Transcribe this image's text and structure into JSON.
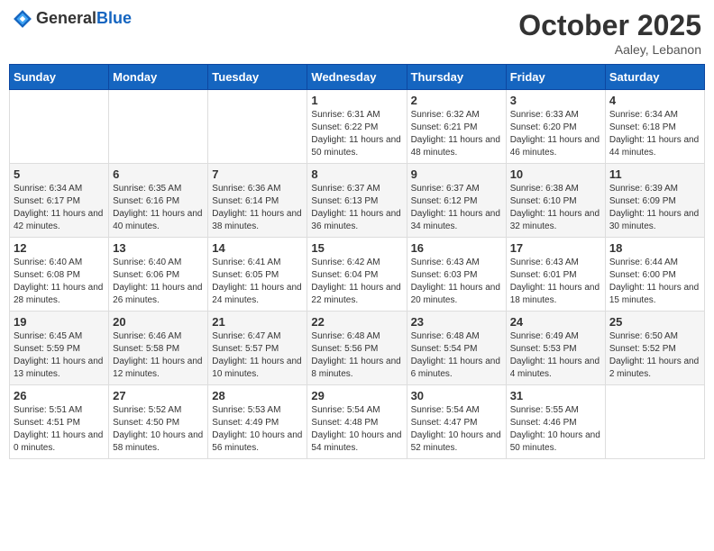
{
  "header": {
    "logo_general": "General",
    "logo_blue": "Blue",
    "month": "October 2025",
    "location": "Aaley, Lebanon"
  },
  "days_of_week": [
    "Sunday",
    "Monday",
    "Tuesday",
    "Wednesday",
    "Thursday",
    "Friday",
    "Saturday"
  ],
  "weeks": [
    [
      {
        "day": "",
        "info": ""
      },
      {
        "day": "",
        "info": ""
      },
      {
        "day": "",
        "info": ""
      },
      {
        "day": "1",
        "info": "Sunrise: 6:31 AM\nSunset: 6:22 PM\nDaylight: 11 hours and 50 minutes."
      },
      {
        "day": "2",
        "info": "Sunrise: 6:32 AM\nSunset: 6:21 PM\nDaylight: 11 hours and 48 minutes."
      },
      {
        "day": "3",
        "info": "Sunrise: 6:33 AM\nSunset: 6:20 PM\nDaylight: 11 hours and 46 minutes."
      },
      {
        "day": "4",
        "info": "Sunrise: 6:34 AM\nSunset: 6:18 PM\nDaylight: 11 hours and 44 minutes."
      }
    ],
    [
      {
        "day": "5",
        "info": "Sunrise: 6:34 AM\nSunset: 6:17 PM\nDaylight: 11 hours and 42 minutes."
      },
      {
        "day": "6",
        "info": "Sunrise: 6:35 AM\nSunset: 6:16 PM\nDaylight: 11 hours and 40 minutes."
      },
      {
        "day": "7",
        "info": "Sunrise: 6:36 AM\nSunset: 6:14 PM\nDaylight: 11 hours and 38 minutes."
      },
      {
        "day": "8",
        "info": "Sunrise: 6:37 AM\nSunset: 6:13 PM\nDaylight: 11 hours and 36 minutes."
      },
      {
        "day": "9",
        "info": "Sunrise: 6:37 AM\nSunset: 6:12 PM\nDaylight: 11 hours and 34 minutes."
      },
      {
        "day": "10",
        "info": "Sunrise: 6:38 AM\nSunset: 6:10 PM\nDaylight: 11 hours and 32 minutes."
      },
      {
        "day": "11",
        "info": "Sunrise: 6:39 AM\nSunset: 6:09 PM\nDaylight: 11 hours and 30 minutes."
      }
    ],
    [
      {
        "day": "12",
        "info": "Sunrise: 6:40 AM\nSunset: 6:08 PM\nDaylight: 11 hours and 28 minutes."
      },
      {
        "day": "13",
        "info": "Sunrise: 6:40 AM\nSunset: 6:06 PM\nDaylight: 11 hours and 26 minutes."
      },
      {
        "day": "14",
        "info": "Sunrise: 6:41 AM\nSunset: 6:05 PM\nDaylight: 11 hours and 24 minutes."
      },
      {
        "day": "15",
        "info": "Sunrise: 6:42 AM\nSunset: 6:04 PM\nDaylight: 11 hours and 22 minutes."
      },
      {
        "day": "16",
        "info": "Sunrise: 6:43 AM\nSunset: 6:03 PM\nDaylight: 11 hours and 20 minutes."
      },
      {
        "day": "17",
        "info": "Sunrise: 6:43 AM\nSunset: 6:01 PM\nDaylight: 11 hours and 18 minutes."
      },
      {
        "day": "18",
        "info": "Sunrise: 6:44 AM\nSunset: 6:00 PM\nDaylight: 11 hours and 15 minutes."
      }
    ],
    [
      {
        "day": "19",
        "info": "Sunrise: 6:45 AM\nSunset: 5:59 PM\nDaylight: 11 hours and 13 minutes."
      },
      {
        "day": "20",
        "info": "Sunrise: 6:46 AM\nSunset: 5:58 PM\nDaylight: 11 hours and 12 minutes."
      },
      {
        "day": "21",
        "info": "Sunrise: 6:47 AM\nSunset: 5:57 PM\nDaylight: 11 hours and 10 minutes."
      },
      {
        "day": "22",
        "info": "Sunrise: 6:48 AM\nSunset: 5:56 PM\nDaylight: 11 hours and 8 minutes."
      },
      {
        "day": "23",
        "info": "Sunrise: 6:48 AM\nSunset: 5:54 PM\nDaylight: 11 hours and 6 minutes."
      },
      {
        "day": "24",
        "info": "Sunrise: 6:49 AM\nSunset: 5:53 PM\nDaylight: 11 hours and 4 minutes."
      },
      {
        "day": "25",
        "info": "Sunrise: 6:50 AM\nSunset: 5:52 PM\nDaylight: 11 hours and 2 minutes."
      }
    ],
    [
      {
        "day": "26",
        "info": "Sunrise: 5:51 AM\nSunset: 4:51 PM\nDaylight: 11 hours and 0 minutes."
      },
      {
        "day": "27",
        "info": "Sunrise: 5:52 AM\nSunset: 4:50 PM\nDaylight: 10 hours and 58 minutes."
      },
      {
        "day": "28",
        "info": "Sunrise: 5:53 AM\nSunset: 4:49 PM\nDaylight: 10 hours and 56 minutes."
      },
      {
        "day": "29",
        "info": "Sunrise: 5:54 AM\nSunset: 4:48 PM\nDaylight: 10 hours and 54 minutes."
      },
      {
        "day": "30",
        "info": "Sunrise: 5:54 AM\nSunset: 4:47 PM\nDaylight: 10 hours and 52 minutes."
      },
      {
        "day": "31",
        "info": "Sunrise: 5:55 AM\nSunset: 4:46 PM\nDaylight: 10 hours and 50 minutes."
      },
      {
        "day": "",
        "info": ""
      }
    ]
  ]
}
